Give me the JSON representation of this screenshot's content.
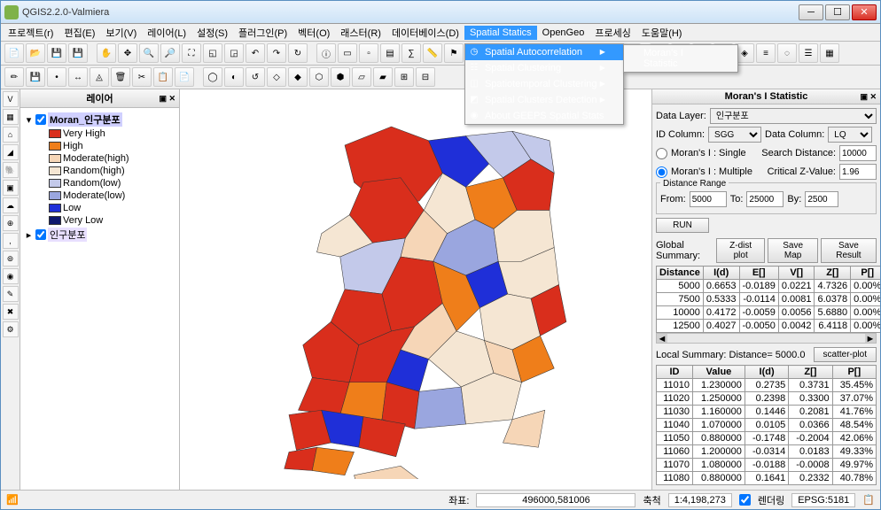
{
  "window": {
    "title": "QGIS2.2.0-Valmiera"
  },
  "menubar": [
    "프로젝트(r)",
    "편집(E)",
    "보기(V)",
    "레이어(L)",
    "설정(S)",
    "플러그인(P)",
    "벡터(O)",
    "래스터(R)",
    "데이터베이스(D)",
    "Spatial Statics",
    "OpenGeo",
    "프로세싱",
    "도움말(H)"
  ],
  "active_menu_index": 9,
  "dropdown": [
    {
      "icon": "◷",
      "label": "Spatial Autocorrelation",
      "arrow": true,
      "hover": true
    },
    {
      "icon": "☷",
      "label": "Spatial Clustering",
      "arrow": true
    },
    {
      "icon": "◫",
      "label": "Spatiotemporal Clustering",
      "arrow": true
    },
    {
      "icon": "◩",
      "label": "Spatial Clusters Detection",
      "arrow": true
    },
    {
      "icon": "◉",
      "label": "About GEEPS Spatial Stats",
      "arrow": false
    }
  ],
  "submenu": [
    {
      "label": "Moran's I Statistic"
    }
  ],
  "layers_panel": {
    "title": "레이어",
    "layers": [
      {
        "name": "Moran_인구분포",
        "expanded": true,
        "checked": true,
        "selected": true,
        "classes": [
          {
            "color": "#d92e1c",
            "label": "Very High"
          },
          {
            "color": "#ef7e1a",
            "label": "High"
          },
          {
            "color": "#f6d6b7",
            "label": "Moderate(high)"
          },
          {
            "color": "#f5e6d3",
            "label": "Random(high)"
          },
          {
            "color": "#c3c9ea",
            "label": "Random(low)"
          },
          {
            "color": "#9aa6df",
            "label": "Moderate(low)"
          },
          {
            "color": "#1f2fd8",
            "label": "Low"
          },
          {
            "color": "#0e176e",
            "label": "Very Low"
          }
        ]
      },
      {
        "name": "인구분포",
        "expanded": false,
        "checked": true,
        "selected2": true
      }
    ]
  },
  "right_panel": {
    "title": "Moran's I Statistic",
    "data_layer_label": "Data Layer:",
    "data_layer_value": "인구분포",
    "id_col_label": "ID Column:",
    "id_col_value": "SGG",
    "data_col_label": "Data Column:",
    "data_col_value": "LQ",
    "single_label": "Moran's I : Single",
    "multiple_label": "Moran's I : Multiple",
    "multiple_selected": true,
    "search_dist_label": "Search Distance:",
    "search_dist_value": "10000",
    "crit_z_label": "Critical Z-Value:",
    "crit_z_value": "1.96",
    "range_title": "Distance Range",
    "from_label": "From:",
    "from_value": "5000",
    "to_label": "To:",
    "to_value": "25000",
    "by_label": "By:",
    "by_value": "2500",
    "run_label": "RUN",
    "global_label": "Global Summary:",
    "zdist_btn": "Z-dist plot",
    "savemap_btn": "Save Map",
    "saveres_btn": "Save Result",
    "global_cols": [
      "Distance",
      "I(d)",
      "E[]",
      "V[]",
      "Z[]",
      "P[]"
    ],
    "global_rows": [
      [
        "5000",
        "0.6653",
        "-0.0189",
        "0.0221",
        "4.7326",
        "0.00%"
      ],
      [
        "7500",
        "0.5333",
        "-0.0114",
        "0.0081",
        "6.0378",
        "0.00%"
      ],
      [
        "10000",
        "0.4172",
        "-0.0059",
        "0.0056",
        "5.6880",
        "0.00%"
      ],
      [
        "12500",
        "0.4027",
        "-0.0050",
        "0.0042",
        "6.4118",
        "0.00%"
      ]
    ],
    "local_label": "Local Summary: Distance= 5000.0",
    "scatter_btn": "scatter-plot",
    "local_cols": [
      "ID",
      "Value",
      "I(d)",
      "Z[]",
      "P[]"
    ],
    "local_rows": [
      [
        "11010",
        "1.230000",
        "0.2735",
        "0.3731",
        "35.45%"
      ],
      [
        "11020",
        "1.250000",
        "0.2398",
        "0.3300",
        "37.07%"
      ],
      [
        "11030",
        "1.160000",
        "0.1446",
        "0.2081",
        "41.76%"
      ],
      [
        "11040",
        "1.070000",
        "0.0105",
        "0.0366",
        "48.54%"
      ],
      [
        "11050",
        "0.880000",
        "-0.1748",
        "-0.2004",
        "42.06%"
      ],
      [
        "11060",
        "1.200000",
        "-0.0314",
        "0.0183",
        "49.33%"
      ],
      [
        "11070",
        "1.080000",
        "-0.0188",
        "-0.0008",
        "49.97%"
      ],
      [
        "11080",
        "0.880000",
        "0.1641",
        "0.2332",
        "40.78%"
      ]
    ]
  },
  "statusbar": {
    "coord_label": "좌표:",
    "coord_value": "496000,581006",
    "scale_label": "축척",
    "scale_value": "1:4,198,273",
    "render_label": "렌더링",
    "epsg": "EPSG:5181"
  },
  "colors": {
    "vh": "#d92e1c",
    "h": "#ef7e1a",
    "mh": "#f6d6b7",
    "rh": "#f5e6d3",
    "rl": "#c3c9ea",
    "ml": "#9aa6df",
    "lo": "#1f2fd8",
    "vl": "#0e176e"
  }
}
